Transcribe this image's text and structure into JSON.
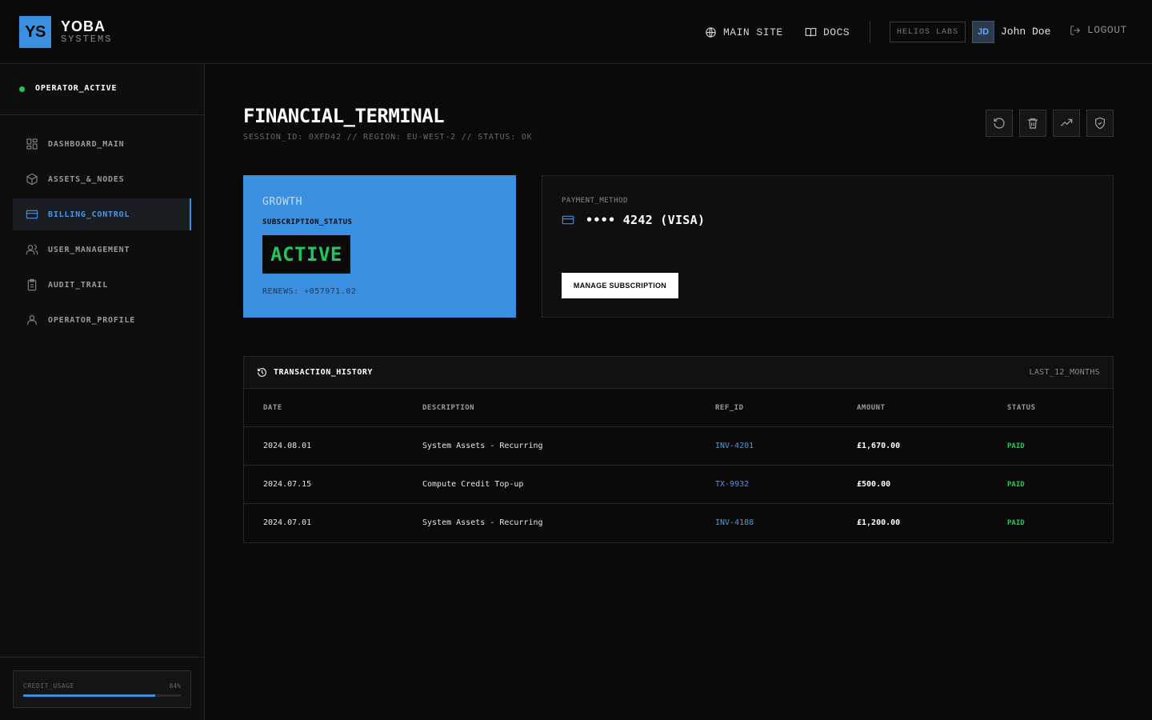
{
  "brand": {
    "logo_text": "YS",
    "name": "YOBA",
    "sub": "SYSTEMS"
  },
  "header": {
    "main_site": "MAIN SITE",
    "docs": "DOCS",
    "org": "HELIOS LABS",
    "avatar_initials": "JD",
    "user_name": "John Doe",
    "logout": "LOGOUT"
  },
  "sidebar": {
    "status": "OPERATOR_ACTIVE",
    "items": [
      {
        "label": "DASHBOARD_MAIN",
        "icon": "dashboard-icon",
        "active": false
      },
      {
        "label": "ASSETS_&_NODES",
        "icon": "cube-icon",
        "active": false
      },
      {
        "label": "BILLING_CONTROL",
        "icon": "credit-card-icon",
        "active": true
      },
      {
        "label": "USER_MANAGEMENT",
        "icon": "users-icon",
        "active": false
      },
      {
        "label": "AUDIT_TRAIL",
        "icon": "clipboard-icon",
        "active": false
      },
      {
        "label": "OPERATOR_PROFILE",
        "icon": "user-icon",
        "active": false
      }
    ],
    "credit": {
      "label": "CREDIT_USAGE",
      "percent_text": "84%",
      "fraction": 0.84
    }
  },
  "page": {
    "title": "FINANCIAL_TERMINAL",
    "meta": "SESSION_ID: 0XFD42 // REGION: EU-WEST-2 // STATUS: OK",
    "toolbar_icons": [
      "refresh-icon",
      "trash-icon",
      "trending-up-icon",
      "shield-check-icon"
    ]
  },
  "plan": {
    "name": "GROWTH",
    "status_label": "SUBSCRIPTION_STATUS",
    "status": "ACTIVE",
    "renews": "RENEWS: +057971.02"
  },
  "payment": {
    "label": "PAYMENT_METHOD",
    "card": "•••• 4242 (VISA)",
    "manage_button": "MANAGE SUBSCRIPTION"
  },
  "transactions": {
    "title": "TRANSACTION_HISTORY",
    "range": "LAST_12_MONTHS",
    "columns": [
      "DATE",
      "DESCRIPTION",
      "REF_ID",
      "AMOUNT",
      "STATUS"
    ],
    "rows": [
      {
        "date": "2024.08.01",
        "description": "System Assets - Recurring",
        "ref": "INV-4201",
        "amount": "£1,670.00",
        "status": "PAID"
      },
      {
        "date": "2024.07.15",
        "description": "Compute Credit Top-up",
        "ref": "TX-9932",
        "amount": "£500.00",
        "status": "PAID"
      },
      {
        "date": "2024.07.01",
        "description": "System Assets - Recurring",
        "ref": "INV-4188",
        "amount": "£1,200.00",
        "status": "PAID"
      }
    ]
  },
  "colors": {
    "accent": "#3b8fe0",
    "success": "#22c55e",
    "background": "#0a0a0a"
  }
}
